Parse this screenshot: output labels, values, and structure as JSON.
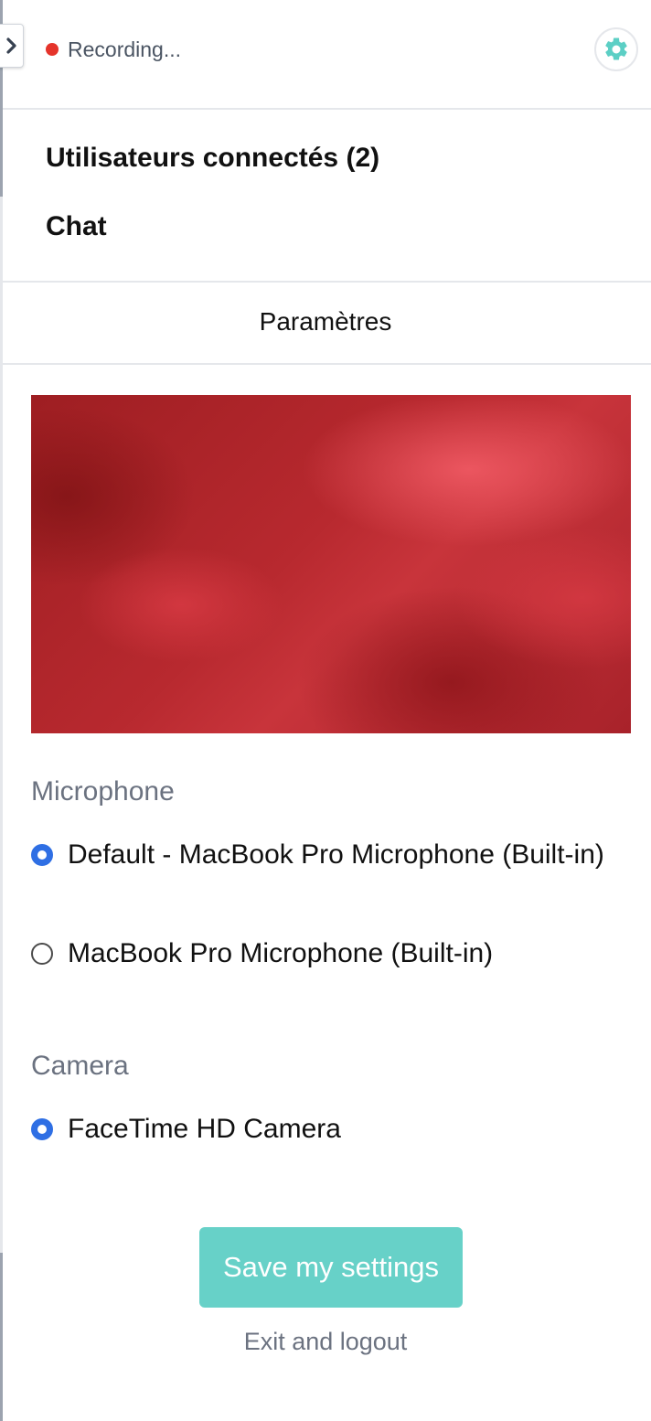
{
  "header": {
    "status_text": "Recording...",
    "status_color": "#e5342b",
    "collapse_icon": "chevron-right-icon",
    "settings_icon": "gear-icon",
    "accent_color": "#5ccfc5"
  },
  "menu": {
    "items": [
      {
        "label": "Utilisateurs connectés (2)"
      },
      {
        "label": "Chat"
      }
    ]
  },
  "settings": {
    "title": "Paramètres",
    "microphone": {
      "label": "Microphone",
      "options": [
        {
          "label": "Default - MacBook Pro Microphone (Built-in)",
          "checked": true
        },
        {
          "label": "MacBook Pro Microphone (Built-in)",
          "checked": false
        }
      ]
    },
    "camera": {
      "label": "Camera",
      "options": [
        {
          "label": "FaceTime HD Camera",
          "checked": true
        }
      ]
    },
    "save_label": "Save my settings",
    "exit_label": "Exit and logout"
  }
}
